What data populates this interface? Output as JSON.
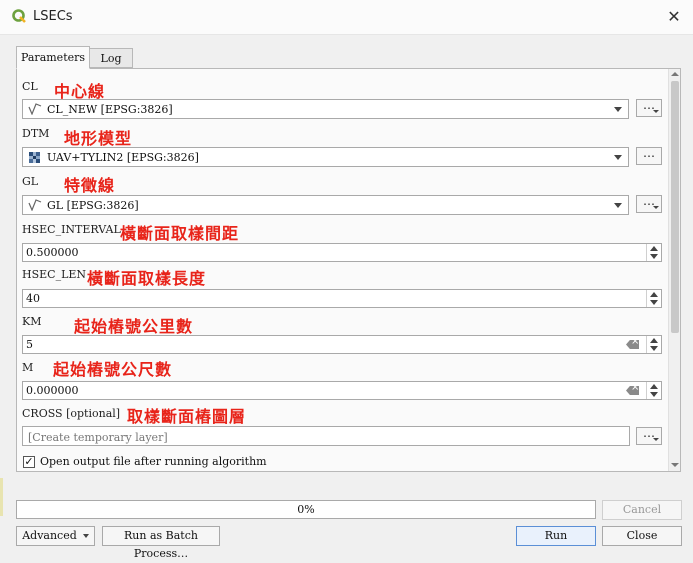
{
  "window": {
    "title": "LSECs",
    "close_glyph": "✕"
  },
  "tabs": [
    {
      "label": "Parameters"
    },
    {
      "label": "Log"
    }
  ],
  "params": {
    "cl": {
      "label": "CL",
      "annotation": "中心線",
      "value": "CL_NEW [EPSG:3826]",
      "icon": "line-layer-icon"
    },
    "dtm": {
      "label": "DTM",
      "annotation": "地形模型",
      "value": "UAV+TYLIN2 [EPSG:3826]",
      "icon": "raster-layer-icon"
    },
    "gl": {
      "label": "GL",
      "annotation": "特徵線",
      "value": "GL [EPSG:3826]",
      "icon": "line-layer-icon"
    },
    "hsec_interval": {
      "label": "HSEC_INTERVAL",
      "annotation": "橫斷面取樣間距",
      "value": "0.500000"
    },
    "hsec_len": {
      "label": "HSEC_LEN",
      "annotation": "橫斷面取樣長度",
      "value": "40"
    },
    "km": {
      "label": "KM",
      "annotation": "起始樁號公里數",
      "value": "5"
    },
    "m": {
      "label": "M",
      "annotation": "起始樁號公尺數",
      "value": "0.000000"
    },
    "cross": {
      "label": "CROSS [optional]",
      "annotation": "取樣斷面樁圖層",
      "placeholder": "[Create temporary layer]"
    },
    "open_output": {
      "label": "Open output file after running algorithm",
      "checked": true
    }
  },
  "dots_label": "…",
  "progress": {
    "value": 0,
    "text": "0%"
  },
  "buttons": {
    "cancel": "Cancel",
    "advanced": "Advanced",
    "batch": "Run as Batch Process…",
    "run": "Run",
    "close": "Close"
  },
  "colors": {
    "annotation": "#e8241a",
    "qgis_green": "#6da13f"
  }
}
